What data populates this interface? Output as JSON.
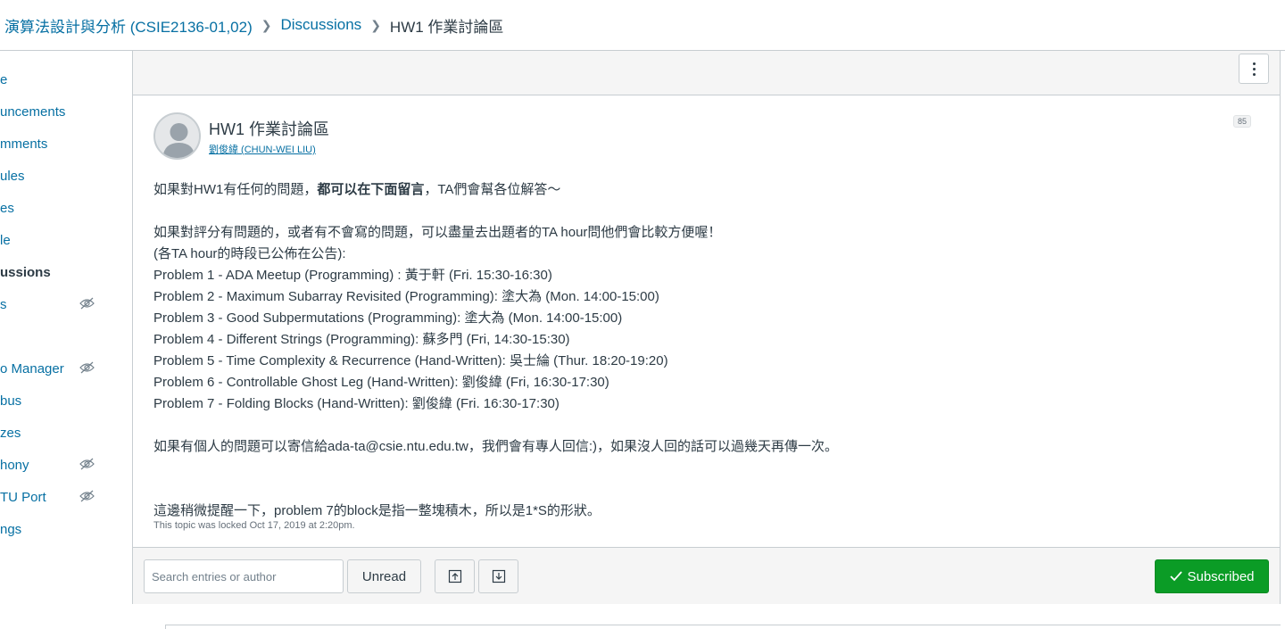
{
  "breadcrumb": {
    "course": "演算法設計與分析 (CSIE2136-01,02)",
    "section": "Discussions",
    "current": "HW1 作業討論區"
  },
  "sidebar": {
    "items": [
      {
        "label": "e",
        "active": false,
        "hidden": false
      },
      {
        "label": "uncements",
        "active": false,
        "hidden": false
      },
      {
        "label": "mments",
        "active": false,
        "hidden": false
      },
      {
        "label": "ules",
        "active": false,
        "hidden": false
      },
      {
        "label": "es",
        "active": false,
        "hidden": false
      },
      {
        "label": "le",
        "active": false,
        "hidden": false
      },
      {
        "label": "ussions",
        "active": true,
        "hidden": false
      },
      {
        "label": "s",
        "active": false,
        "hidden": true
      },
      {
        "label": "",
        "active": false,
        "hidden": false
      },
      {
        "label": "o Manager",
        "active": false,
        "hidden": true
      },
      {
        "label": "bus",
        "active": false,
        "hidden": false
      },
      {
        "label": "zes",
        "active": false,
        "hidden": false
      },
      {
        "label": "hony",
        "active": false,
        "hidden": true
      },
      {
        "label": "TU Port",
        "active": false,
        "hidden": true
      },
      {
        "label": "ngs",
        "active": false,
        "hidden": false
      }
    ]
  },
  "post": {
    "title": "HW1 作業討論區",
    "author": "劉俊緯 (CHUN-WEI LIU)",
    "reply_count": "85",
    "lines": {
      "l1a": "如果對HW1有任何的問題，",
      "l1b": "都可以在下面留言",
      "l1c": "，TA們會幫各位解答～",
      "l2": "如果對評分有問題的，或者有不會寫的問題，可以盡量去出題者的TA hour問他們會比較方便喔！",
      "l3": "(各TA hour的時段已公佈在公告):",
      "p1": "Problem 1 - ADA Meetup (Programming) : 黃于軒 (Fri. 15:30-16:30)",
      "p2": "Problem 2 - Maximum Subarray Revisited (Programming): 塗大為 (Mon. 14:00-15:00)",
      "p3": "Problem 3 - Good Subpermutations (Programming): 塗大為 (Mon. 14:00-15:00)",
      "p4": "Problem 4 - Different Strings (Programming): 蘇多門 (Fri, 14:30-15:30)",
      "p5": "Problem 5 - Time Complexity & Recurrence (Hand-Written): 吳士綸 (Thur. 18:20-19:20)",
      "p6": "Problem 6 - Controllable Ghost Leg (Hand-Written): 劉俊緯 (Fri, 16:30-17:30)",
      "p7": "Problem 7 - Folding Blocks (Hand-Written): 劉俊緯 (Fri. 16:30-17:30)",
      "l4": "如果有個人的問題可以寄信給ada-ta@csie.ntu.edu.tw，我們會有專人回信:)，如果沒人回的話可以過幾天再傳一次。",
      "l5": "這邊稍微提醒一下，problem 7的block是指一整塊積木，所以是1*S的形狀。"
    },
    "lock_note": "This topic was locked Oct 17, 2019 at 2:20pm."
  },
  "footer": {
    "search_placeholder": "Search entries or author",
    "unread_label": "Unread",
    "subscribed_label": "Subscribed"
  },
  "colors": {
    "link": "#0770a3",
    "subscribed_bg": "#0b9c26",
    "text": "#2d3b45"
  }
}
